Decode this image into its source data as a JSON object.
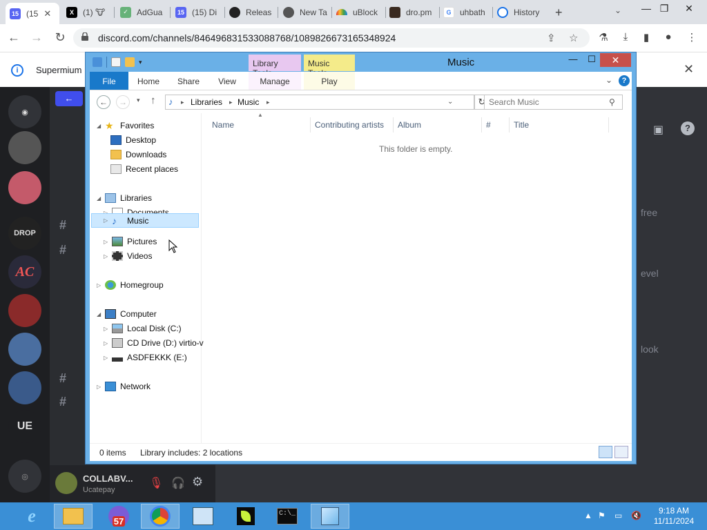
{
  "browser": {
    "tabs": [
      {
        "label": "(15",
        "icon": "discord-icon",
        "badge": "15",
        "active": true
      },
      {
        "label": "(1) 🐮",
        "icon": "x-icon"
      },
      {
        "label": "AdGua",
        "icon": "adguard-shield-icon"
      },
      {
        "label": "(15) Di",
        "icon": "discord-icon",
        "badge": "15"
      },
      {
        "label": "Releas",
        "icon": "github-icon"
      },
      {
        "label": "New Ta",
        "icon": "chrome-icon"
      },
      {
        "label": "uBlock",
        "icon": "rainbow-icon"
      },
      {
        "label": "dro.pm",
        "icon": "page-icon"
      },
      {
        "label": "uhbath",
        "icon": "google-icon"
      },
      {
        "label": "History",
        "icon": "history-icon"
      }
    ],
    "url": "discord.com/channels/846496831533088768/1089826673165348924",
    "infobar_text": "Supermium"
  },
  "discord": {
    "servers": [
      "",
      "",
      "",
      "DROP",
      "AC",
      "",
      "",
      "",
      "UE"
    ],
    "user_name": "COLLABV...",
    "user_status": "Ucatepay",
    "right_snippets": [
      "free",
      "evel",
      "look"
    ]
  },
  "explorer": {
    "title": "Music",
    "context_tabs": [
      "Library Tools",
      "Music Tools"
    ],
    "ribbon_tabs": [
      "File",
      "Home",
      "Share",
      "View",
      "Manage",
      "Play"
    ],
    "breadcrumb": [
      "Libraries",
      "Music"
    ],
    "search_placeholder": "Search Music",
    "nav": {
      "favorites": {
        "label": "Favorites",
        "items": [
          "Desktop",
          "Downloads",
          "Recent places"
        ]
      },
      "libraries": {
        "label": "Libraries",
        "items": [
          "Documents",
          "Music",
          "Pictures",
          "Videos"
        ],
        "selected": "Music"
      },
      "homegroup": "Homegroup",
      "computer": {
        "label": "Computer",
        "items": [
          "Local Disk (C:)",
          "CD Drive (D:) virtio-v",
          "ASDFEKKK (E:)"
        ]
      },
      "network": "Network"
    },
    "columns": [
      "Name",
      "Contributing artists",
      "Album",
      "#",
      "Title"
    ],
    "empty_message": "This folder is empty.",
    "status": {
      "items": "0 items",
      "library": "Library includes: 2 locations"
    }
  },
  "taskbar": {
    "badge": "57",
    "time": "9:18 AM",
    "date": "11/11/2024"
  },
  "colors": {
    "accent": "#1979ca",
    "window_frame": "#6ab0e7",
    "taskbar": "#3a8fd6",
    "discord_bg": "#313338",
    "library_tools": "#e8c8f0",
    "music_tools": "#f4eb8a"
  }
}
